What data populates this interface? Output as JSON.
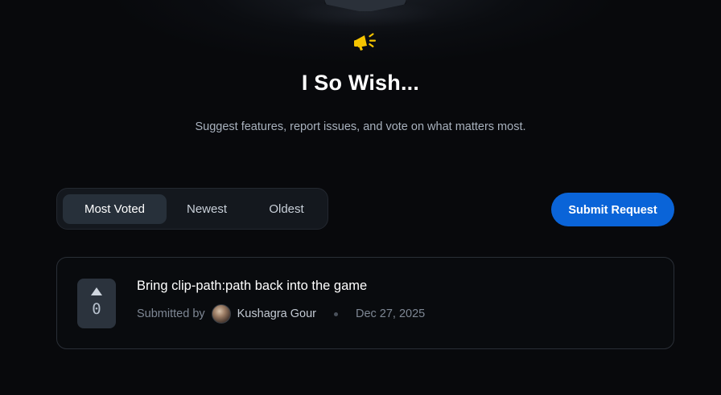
{
  "header": {
    "title": "I So Wish...",
    "subtitle": "Suggest features, report issues, and vote on what matters most."
  },
  "icons": {
    "hero": "megaphone-icon",
    "upvote": "triangle-up-icon"
  },
  "colors": {
    "accent": "#0a64d8",
    "megaphone": "#f5c400",
    "background": "#08090c"
  },
  "sort_tabs": [
    {
      "label": "Most Voted",
      "active": true
    },
    {
      "label": "Newest",
      "active": false
    },
    {
      "label": "Oldest",
      "active": false
    }
  ],
  "actions": {
    "submit_label": "Submit Request"
  },
  "requests": [
    {
      "title": "Bring clip-path:path back into the game",
      "votes": "0",
      "submitted_by_label": "Submitted by",
      "author": "Kushagra Gour",
      "date": "Dec 27, 2025"
    }
  ]
}
